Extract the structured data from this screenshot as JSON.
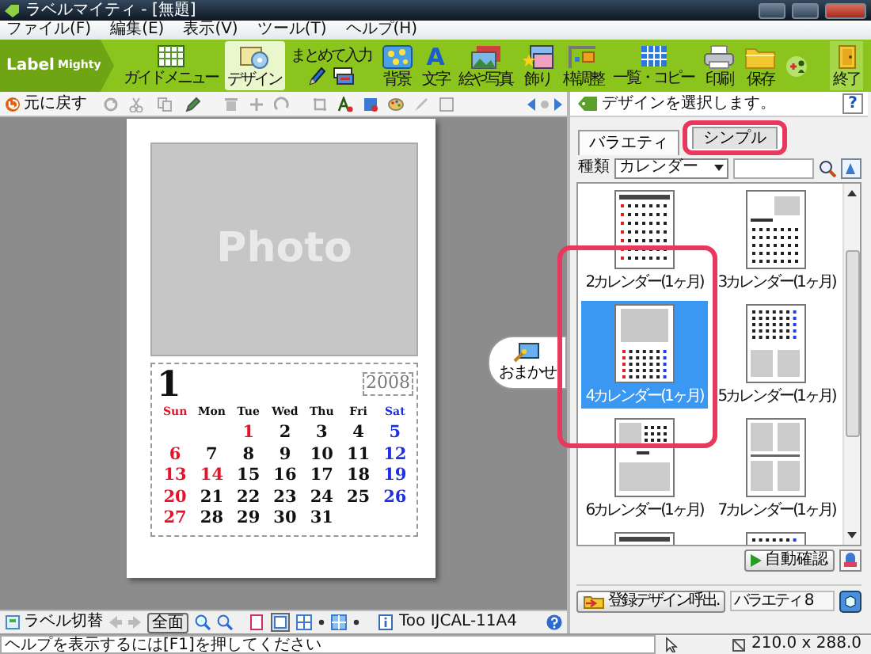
{
  "window": {
    "title": "ラベルマイティ - [無題]"
  },
  "menu": [
    "ファイル(F)",
    "編集(E)",
    "表示(V)",
    "ツール(T)",
    "ヘルプ(H)"
  ],
  "logo": {
    "word_1": "Label",
    "word_2": "Mighty"
  },
  "ribbon": [
    {
      "label": "ガイドメニュー",
      "kind": "calendar",
      "selected": false
    },
    {
      "label": "デザイン",
      "kind": "design",
      "selected": true
    },
    {
      "label": "まとめて入力",
      "kind": "batch",
      "selected": false
    },
    {
      "label": "背景",
      "kind": "background",
      "selected": false
    },
    {
      "label": "文字",
      "kind": "letter",
      "glyph": "A",
      "selected": false
    },
    {
      "label": "絵や写真",
      "kind": "photos",
      "selected": false
    },
    {
      "label": "飾り",
      "kind": "decoration",
      "selected": false
    },
    {
      "label": "枠調整",
      "kind": "frame",
      "selected": false
    },
    {
      "label": "一覧・コピー",
      "kind": "list",
      "selected": false
    },
    {
      "label": "印刷",
      "kind": "printer",
      "selected": false
    },
    {
      "label": "保存",
      "kind": "folder",
      "selected": false
    },
    {
      "kind": "add",
      "selected": false
    },
    {
      "label": "終了",
      "kind": "door",
      "selected": false
    }
  ],
  "toolbar": {
    "undo": "元に戻す"
  },
  "page": {
    "photo_label": "Photo",
    "calendar": {
      "month": "1",
      "year": "2008",
      "weekdays": [
        {
          "text": "Sun",
          "kind": "sunday"
        },
        {
          "text": "Mon",
          "kind": "weekday"
        },
        {
          "text": "Tue",
          "kind": "weekday"
        },
        {
          "text": "Wed",
          "kind": "weekday"
        },
        {
          "text": "Thu",
          "kind": "weekday"
        },
        {
          "text": "Fri",
          "kind": "weekday"
        },
        {
          "text": "Sat",
          "kind": "saturday"
        }
      ],
      "weeks": [
        {
          "days": [
            {
              "kind": "blank"
            },
            {
              "kind": "blank"
            },
            {
              "text": "1",
              "kind": "holiday"
            },
            {
              "text": "2",
              "kind": "weekday"
            },
            {
              "text": "3",
              "kind": "weekday"
            },
            {
              "text": "4",
              "kind": "weekday"
            },
            {
              "text": "5",
              "kind": "saturday"
            }
          ]
        },
        {
          "days": [
            {
              "text": "6",
              "kind": "sunday"
            },
            {
              "text": "7",
              "kind": "weekday"
            },
            {
              "text": "8",
              "kind": "weekday"
            },
            {
              "text": "9",
              "kind": "weekday"
            },
            {
              "text": "10",
              "kind": "weekday"
            },
            {
              "text": "11",
              "kind": "weekday"
            },
            {
              "text": "12",
              "kind": "saturday"
            }
          ]
        },
        {
          "days": [
            {
              "text": "13",
              "kind": "sunday"
            },
            {
              "text": "14",
              "kind": "holiday"
            },
            {
              "text": "15",
              "kind": "weekday"
            },
            {
              "text": "16",
              "kind": "weekday"
            },
            {
              "text": "17",
              "kind": "weekday"
            },
            {
              "text": "18",
              "kind": "weekday"
            },
            {
              "text": "19",
              "kind": "saturday"
            }
          ]
        },
        {
          "days": [
            {
              "text": "20",
              "kind": "sunday"
            },
            {
              "text": "21",
              "kind": "weekday"
            },
            {
              "text": "22",
              "kind": "weekday"
            },
            {
              "text": "23",
              "kind": "weekday"
            },
            {
              "text": "24",
              "kind": "weekday"
            },
            {
              "text": "25",
              "kind": "weekday"
            },
            {
              "text": "26",
              "kind": "saturday"
            }
          ]
        },
        {
          "days": [
            {
              "text": "27",
              "kind": "sunday"
            },
            {
              "text": "28",
              "kind": "weekday"
            },
            {
              "text": "29",
              "kind": "weekday"
            },
            {
              "text": "30",
              "kind": "weekday"
            },
            {
              "text": "31",
              "kind": "weekday"
            }
          ]
        }
      ]
    }
  },
  "assist_button": "おまかせ",
  "panel": {
    "hint": "デザインを選択します。",
    "help": "?",
    "tabs": [
      {
        "label": "バラエティ",
        "selected": true
      },
      {
        "label": "シンプル",
        "selected": false
      }
    ],
    "type_label": "種類",
    "type_value": "カレンダー",
    "designs": [
      {
        "label": "2カレンダー(1ヶ月)",
        "kind": "month-list",
        "selected": false
      },
      {
        "label": "3カレンダー(1ヶ月)",
        "kind": "photo-grid",
        "selected": false
      },
      {
        "label": "4カレンダー(1ヶ月)",
        "kind": "photo-top",
        "selected": true
      },
      {
        "label": "5カレンダー(1ヶ月)",
        "kind": "grid-photos",
        "selected": false
      },
      {
        "label": "6カレンダー(1ヶ月)",
        "kind": "photo-middle",
        "selected": false
      },
      {
        "label": "7カレンダー(1ヶ月)",
        "kind": "four-photos",
        "selected": false
      },
      {
        "kind": "month-list",
        "selected": false
      },
      {
        "kind": "grid-photos",
        "selected": false
      }
    ],
    "check_button": "自動確認",
    "load_button": "登録デザイン呼出.",
    "set_name": "バラエティ 8"
  },
  "bottom_toolbar": {
    "switch": "ラベル切替",
    "fit": "全面",
    "printer": "Too IJCAL-11A4"
  },
  "status_bar": {
    "help": "ヘルプを表示するには[F1]を押してください",
    "size": "210.0 x 288.0"
  }
}
